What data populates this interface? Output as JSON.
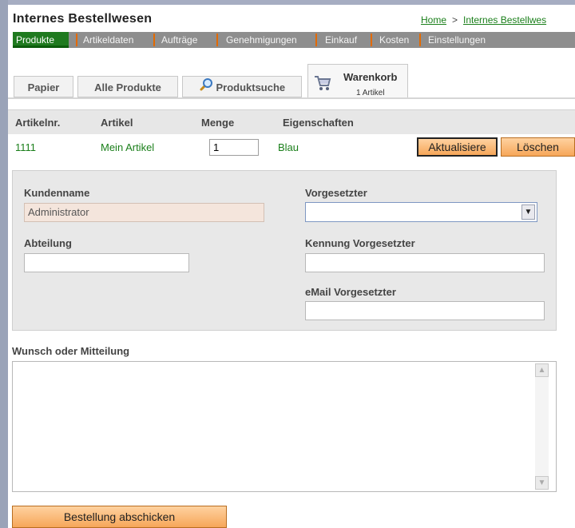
{
  "app": {
    "title": "Internes Bestellwesen"
  },
  "breadcrumb": {
    "home": "Home",
    "separator": ">",
    "current": "Internes Bestellwes"
  },
  "nav": {
    "items": [
      "Produkte",
      "Artikeldaten",
      "Aufträge",
      "Genehmigungen",
      "Einkauf",
      "Kosten",
      "Einstellungen"
    ],
    "active": "Produkte"
  },
  "tabs": {
    "papier": "Papier",
    "alle": "Alle Produkte",
    "suche": "Produktsuche",
    "warenkorb": {
      "title": "Warenkorb",
      "count": "1 Artikel"
    }
  },
  "cart": {
    "headers": {
      "artikelnr": "Artikelnr.",
      "artikel": "Artikel",
      "menge": "Menge",
      "eigenschaften": "Eigenschaften"
    },
    "row": {
      "artikelnr": "1111",
      "artikel": "Mein Artikel",
      "menge": "1",
      "eigenschaften": "Blau"
    },
    "update_label": "Aktualisiere",
    "delete_label": "Löschen"
  },
  "form": {
    "kundenname_label": "Kundenname",
    "kundenname_value": "Administrator",
    "abteilung_label": "Abteilung",
    "abteilung_value": "",
    "vorgesetzter_label": "Vorgesetzter",
    "vorgesetzter_value": "",
    "kennung_label": "Kennung Vorgesetzter",
    "kennung_value": "",
    "email_label": "eMail Vorgesetzter",
    "email_value": ""
  },
  "message": {
    "label": "Wunsch oder Mitteilung",
    "value": ""
  },
  "submit_label": "Bestellung abschicken",
  "colors": {
    "accent_orange": "#f6a659",
    "nav_green": "#1f7a1f",
    "link_green": "#1a7f1a"
  }
}
